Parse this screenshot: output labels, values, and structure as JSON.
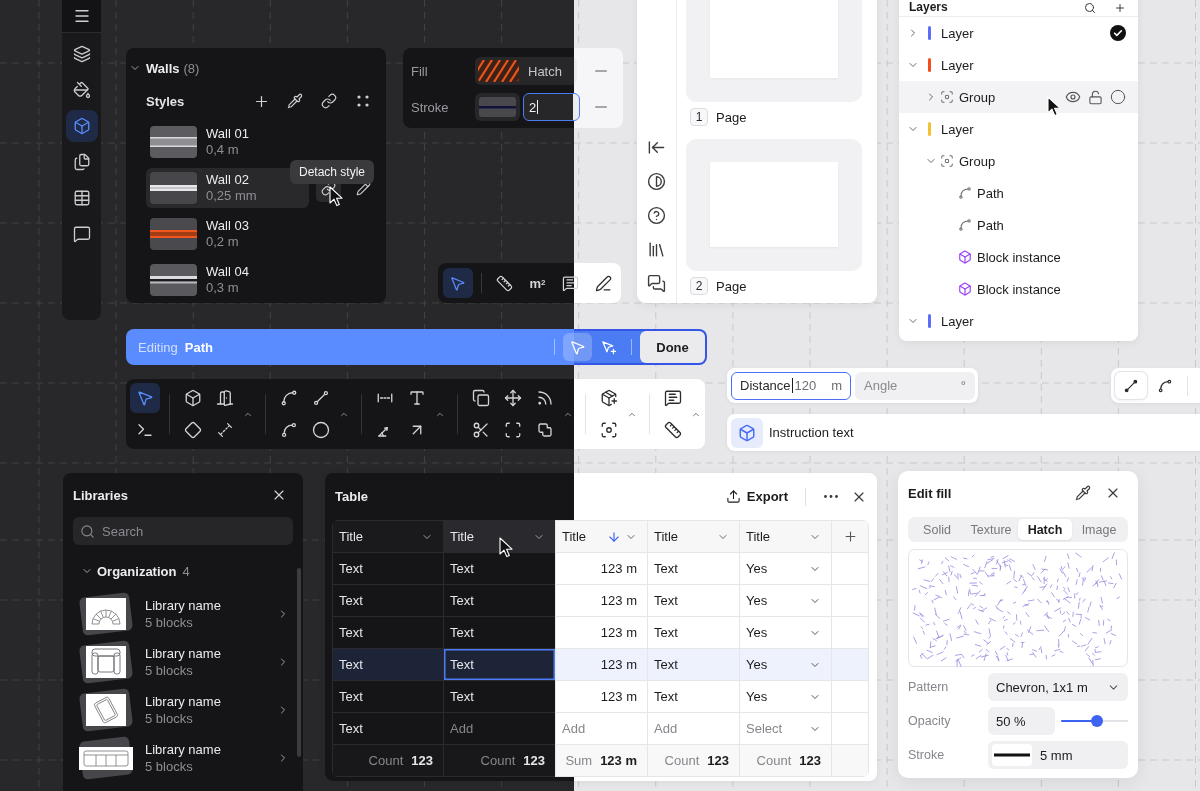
{
  "sidebar": {
    "items": [
      {
        "selected": false
      },
      {
        "selected": false
      },
      {
        "selected": true
      },
      {
        "selected": false
      },
      {
        "selected": false
      },
      {
        "selected": false
      }
    ]
  },
  "walls": {
    "title": "Walls",
    "count": "(8)",
    "expanded": true,
    "styles_label": "Styles",
    "tooltip": "Detach style",
    "styles": [
      {
        "name": "Wall 01",
        "size": "0,4 m",
        "kind": "plain",
        "selected": false
      },
      {
        "name": "Wall 02",
        "size": "0,25 mm",
        "kind": "thin",
        "selected": true
      },
      {
        "name": "Wall 03",
        "size": "0,2 m",
        "kind": "accent",
        "selected": false
      },
      {
        "name": "Wall 04",
        "size": "0,3 m",
        "kind": "double",
        "selected": false
      }
    ]
  },
  "fill_stroke": {
    "rows": [
      {
        "label": "Fill",
        "kind": "hatch",
        "value": "Hatch",
        "focused": false
      },
      {
        "label": "Stroke",
        "kind": "line",
        "value": "2",
        "focused": true
      }
    ]
  },
  "mini_toolbar": {
    "tools": [
      {
        "selected": true
      },
      {
        "selected": false
      },
      {
        "selected": false,
        "label": "m$^{2}$"
      },
      {
        "selected": false
      },
      {
        "selected": false
      }
    ]
  },
  "editing": {
    "label": "Editing",
    "target": "Path",
    "tools": [
      {
        "selected": true
      },
      {
        "selected": false
      }
    ],
    "done": "Done"
  },
  "toolbar": {
    "groups": [
      {
        "more": false,
        "tools": [
          {
            "selected": true
          },
          {
            "selected": false
          }
        ]
      },
      {
        "more": true,
        "tools": [
          {
            "selected": false
          },
          {
            "selected": false
          },
          {
            "selected": false
          },
          {
            "selected": false
          }
        ]
      },
      {
        "more": true,
        "tools": [
          {
            "selected": false
          },
          {
            "selected": false
          },
          {
            "selected": false
          },
          {
            "selected": false
          }
        ]
      },
      {
        "more": true,
        "tools": [
          {
            "selected": false
          },
          {
            "selected": false
          },
          {
            "selected": false
          },
          {
            "selected": false
          }
        ]
      },
      {
        "more": true,
        "tools": [
          {
            "selected": false
          },
          {
            "selected": false
          },
          {
            "selected": false
          },
          {
            "selected": false
          },
          {
            "selected": false
          },
          {
            "selected": false
          }
        ]
      },
      {
        "more": true,
        "tools": [
          {
            "selected": false
          },
          {
            "selected": false
          }
        ]
      },
      {
        "more": true,
        "tools": [
          {
            "selected": false
          },
          {
            "selected": false
          }
        ]
      }
    ]
  },
  "measure": {
    "distance": {
      "label": "Distance",
      "value": "120",
      "unit": "m",
      "focused": true
    },
    "angle": {
      "placeholder": "Angle",
      "unit": "°",
      "focused": false
    }
  },
  "line_modes": {
    "items": [
      {
        "selected": true
      },
      {
        "selected": false
      }
    ]
  },
  "instruction": {
    "text": "Instruction text"
  },
  "pages": {
    "items": [
      {
        "number": "1",
        "label": "Page"
      },
      {
        "number": "2",
        "label": "Page"
      }
    ]
  },
  "layers": {
    "title": "Layers",
    "items": [
      {
        "kind": "layer",
        "name": "Layer",
        "color": "#5b6ef7",
        "expanded": false,
        "checked": true,
        "hovered": false
      },
      {
        "kind": "layer",
        "name": "Layer",
        "color": "#f24e1e",
        "expanded": true,
        "checked": false,
        "hovered": false,
        "children": [
          {
            "kind": "group",
            "name": "Group",
            "expanded": false,
            "checked": false,
            "hovered": true
          }
        ]
      },
      {
        "kind": "layer",
        "name": "Layer",
        "color": "#f2c230",
        "expanded": true,
        "checked": false,
        "hovered": false,
        "children": [
          {
            "kind": "group",
            "name": "Group",
            "expanded": true,
            "checked": false,
            "hovered": false,
            "children": [
              {
                "kind": "path",
                "name": "Path",
                "checked": false,
                "hovered": false
              },
              {
                "kind": "path",
                "name": "Path",
                "checked": false,
                "hovered": false
              },
              {
                "kind": "block",
                "name": "Block instance",
                "checked": false,
                "hovered": false
              },
              {
                "kind": "block",
                "name": "Block instance",
                "checked": false,
                "hovered": false
              }
            ]
          }
        ]
      },
      {
        "kind": "layer",
        "name": "Layer",
        "color": "#5b6ef7",
        "expanded": true,
        "checked": false,
        "hovered": false
      }
    ]
  },
  "libraries": {
    "title": "Libraries",
    "search": {
      "placeholder": "Search"
    },
    "section": {
      "name": "Organization",
      "count": "4",
      "expanded": true
    },
    "items": [
      {
        "name": "Library name",
        "blocks": "5 blocks"
      },
      {
        "name": "Library name",
        "blocks": "5 blocks"
      },
      {
        "name": "Library name",
        "blocks": "5 blocks"
      },
      {
        "name": "Library name",
        "blocks": "5 blocks"
      }
    ]
  },
  "table": {
    "title": "Table",
    "export": "Export",
    "columns": [
      {
        "title": "Title",
        "kind": "text",
        "sorted": false,
        "hovered": false
      },
      {
        "title": "Title",
        "kind": "text",
        "sorted": false,
        "hovered": true
      },
      {
        "title": "Title",
        "kind": "number",
        "sorted": true,
        "hovered": false
      },
      {
        "title": "Title",
        "kind": "text",
        "sorted": false,
        "hovered": false
      },
      {
        "title": "Title",
        "kind": "select",
        "sorted": false,
        "hovered": false
      }
    ],
    "rows": [
      {
        "selected": false,
        "cells": [
          {
            "value": "Text",
            "focused": false
          },
          {
            "value": "Text",
            "focused": false
          },
          {
            "value": "123 m",
            "focused": false
          },
          {
            "value": "Text",
            "focused": false
          },
          {
            "value": "Yes",
            "focused": false
          }
        ]
      },
      {
        "selected": false,
        "cells": [
          {
            "value": "Text",
            "focused": false
          },
          {
            "value": "Text",
            "focused": false
          },
          {
            "value": "123 m",
            "focused": false
          },
          {
            "value": "Text",
            "focused": false
          },
          {
            "value": "Yes",
            "focused": false
          }
        ]
      },
      {
        "selected": false,
        "cells": [
          {
            "value": "Text",
            "focused": false
          },
          {
            "value": "Text",
            "focused": false
          },
          {
            "value": "123 m",
            "focused": false
          },
          {
            "value": "Text",
            "focused": false
          },
          {
            "value": "Yes",
            "focused": false
          }
        ]
      },
      {
        "selected": true,
        "cells": [
          {
            "value": "Text",
            "focused": false
          },
          {
            "value": "Text",
            "focused": true
          },
          {
            "value": "123 m",
            "focused": false
          },
          {
            "value": "Text",
            "focused": false
          },
          {
            "value": "Yes",
            "focused": false
          }
        ]
      },
      {
        "selected": false,
        "cells": [
          {
            "value": "Text",
            "focused": false
          },
          {
            "value": "Text",
            "focused": false
          },
          {
            "value": "123 m",
            "focused": false
          },
          {
            "value": "Text",
            "focused": false
          },
          {
            "value": "Yes",
            "focused": false
          }
        ]
      },
      {
        "selected": false,
        "cells": [
          {
            "value": "Text",
            "focused": false
          },
          {
            "placeholder": "Add",
            "focused": false
          },
          {
            "placeholder": "Add",
            "focused": false
          },
          {
            "placeholder": "Add",
            "focused": false
          },
          {
            "placeholder": "Select",
            "focused": false
          }
        ]
      }
    ],
    "footer": [
      "Count **123**",
      "Count **123**",
      "Sum **123 m**",
      "Count **123**",
      "Count **123**"
    ]
  },
  "edit_fill": {
    "title": "Edit fill",
    "tabs": [
      {
        "label": "Solid",
        "selected": false
      },
      {
        "label": "Texture",
        "selected": false
      },
      {
        "label": "Hatch",
        "selected": true
      },
      {
        "label": "Image",
        "selected": false
      }
    ],
    "pattern": {
      "label": "Pattern",
      "value": "Chevron, 1x1 m"
    },
    "opacity": {
      "label": "Opacity",
      "value": "50 %",
      "level": 0.54
    },
    "stroke": {
      "label": "Stroke",
      "value": "5 mm"
    }
  }
}
